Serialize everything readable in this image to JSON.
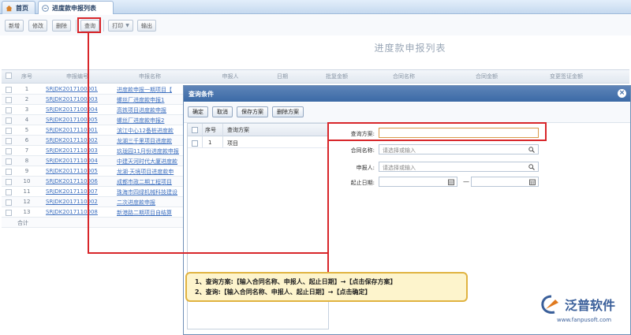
{
  "tabs": [
    {
      "label": "首页",
      "icon": "home-icon"
    },
    {
      "label": "进度款申报列表",
      "icon": "list-icon"
    }
  ],
  "toolbar": {
    "new": "新增",
    "edit": "修改",
    "delete": "删除",
    "query": "查询",
    "print": "打印",
    "export": "输出"
  },
  "page_title": "进度款申报列表",
  "grid": {
    "headers": [
      "序号",
      "申报编号",
      "申报名称",
      "申报人",
      "日期",
      "批复金额",
      "合同名称",
      "合同金额",
      "变更签证金额"
    ],
    "rows": [
      {
        "seq": "1",
        "code": "SRJDK2017100001",
        "name": "进度款申报一期项目【"
      },
      {
        "seq": "2",
        "code": "SRJDK2017100003",
        "name": "螺丝厂进度款申报1"
      },
      {
        "seq": "3",
        "code": "SRJDK2017100004",
        "name": "高铁项目进度款申报"
      },
      {
        "seq": "4",
        "code": "SRJDK2017100005",
        "name": "螺丝厂进度款申报2"
      },
      {
        "seq": "5",
        "code": "SRJDK2017110001",
        "name": "滨江中心12备桩进度款"
      },
      {
        "seq": "6",
        "code": "SRJDK2017110002",
        "name": "龙湖三千里项目进度款"
      },
      {
        "seq": "7",
        "code": "SRJDK2017110003",
        "name": "玖珑园11月份进度款申报"
      },
      {
        "seq": "8",
        "code": "SRJDK2017110004",
        "name": "中建天河时代大厦进度款"
      },
      {
        "seq": "9",
        "code": "SRJDK2017110005",
        "name": "龙湖·天境项目进度款申"
      },
      {
        "seq": "10",
        "code": "SRJDK2017110006",
        "name": "成都市政二期工程项目"
      },
      {
        "seq": "11",
        "code": "SRJDK2017110007",
        "name": "珠海市四绿机械科技建设"
      },
      {
        "seq": "12",
        "code": "SRJDK2017110002",
        "name": "二次进度款申报"
      },
      {
        "seq": "13",
        "code": "SRJDK2017110008",
        "name": "新港路二期项目自结算"
      }
    ],
    "total_label": "合计"
  },
  "dialog": {
    "title": "查询条件",
    "buttons": {
      "confirm": "确定",
      "cancel": "取消",
      "save_plan": "保存方案",
      "delete_plan": "删除方案"
    },
    "plan_headers": {
      "seq": "序号",
      "plan": "查询方案"
    },
    "plans": [
      {
        "seq": "1",
        "name": "项目"
      }
    ],
    "fields": {
      "plan_label": "查询方案:",
      "contract_label": "合同名称:",
      "contract_placeholder": "请选择或输入",
      "reporter_label": "申报人:",
      "reporter_placeholder": "请选择或输入",
      "date_label": "起止日期:",
      "date_sep": "—"
    }
  },
  "annotation": {
    "line1": "1、查询方案:【输入合同名称、申报人、起止日期】→【点击保存方案】",
    "line2": "2、查询:【输入合同名称、申报人、起止日期】→【点击确定】"
  },
  "brand": {
    "name": "泛普软件",
    "url": "www.fanpusoft.com"
  },
  "colors": {
    "accent": "#3b6aa6",
    "highlight": "#d8262a",
    "note_bg": "#fdf4cc",
    "link": "#3f71c0"
  }
}
